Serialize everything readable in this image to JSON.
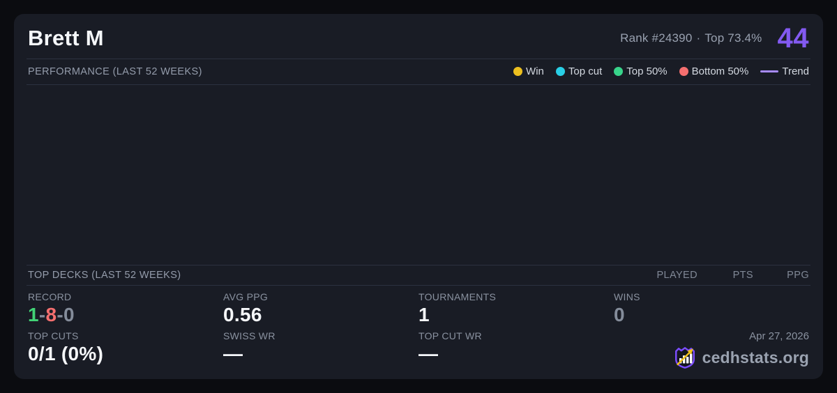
{
  "header": {
    "player_name": "Brett M",
    "rank_label": "Rank #24390",
    "separator": "·",
    "top_percent_label": "Top 73.4%",
    "points": "44"
  },
  "performance": {
    "title": "PERFORMANCE (LAST 52 WEEKS)",
    "legend": [
      {
        "label": "Win",
        "color": "#edc01f",
        "marker": "dot"
      },
      {
        "label": "Top cut",
        "color": "#29cfe6",
        "marker": "dot"
      },
      {
        "label": "Top 50%",
        "color": "#38d48a",
        "marker": "dot"
      },
      {
        "label": "Bottom 50%",
        "color": "#f56f6f",
        "marker": "dot"
      },
      {
        "label": "Trend",
        "color": "#a78bfa",
        "marker": "line"
      }
    ],
    "chart_points": []
  },
  "top_decks": {
    "title": "TOP DECKS (LAST 52 WEEKS)",
    "columns": [
      "PLAYED",
      "PTS",
      "PPG"
    ],
    "rows": []
  },
  "stats": {
    "record": {
      "label": "RECORD",
      "wins": "1",
      "losses": "8",
      "draws": "0",
      "dash": "-"
    },
    "avg_ppg": {
      "label": "AVG PPG",
      "value": "0.56"
    },
    "tournaments": {
      "label": "TOURNAMENTS",
      "value": "1"
    },
    "wins": {
      "label": "WINS",
      "value": "0"
    },
    "top_cuts": {
      "label": "TOP CUTS",
      "value": "0/1 (0%)"
    },
    "swiss_wr": {
      "label": "SWISS WR",
      "value": "—"
    },
    "top_cut_wr": {
      "label": "TOP CUT WR",
      "value": "—"
    }
  },
  "footer": {
    "date": "Apr 27, 2026",
    "brand": "cedhstats.org"
  },
  "colors": {
    "accent_purple": "#835af1",
    "win_green": "#42d376",
    "loss_red": "#f56f6f",
    "neutral_gray": "#848c9a",
    "muted_value": "#848c9a"
  }
}
